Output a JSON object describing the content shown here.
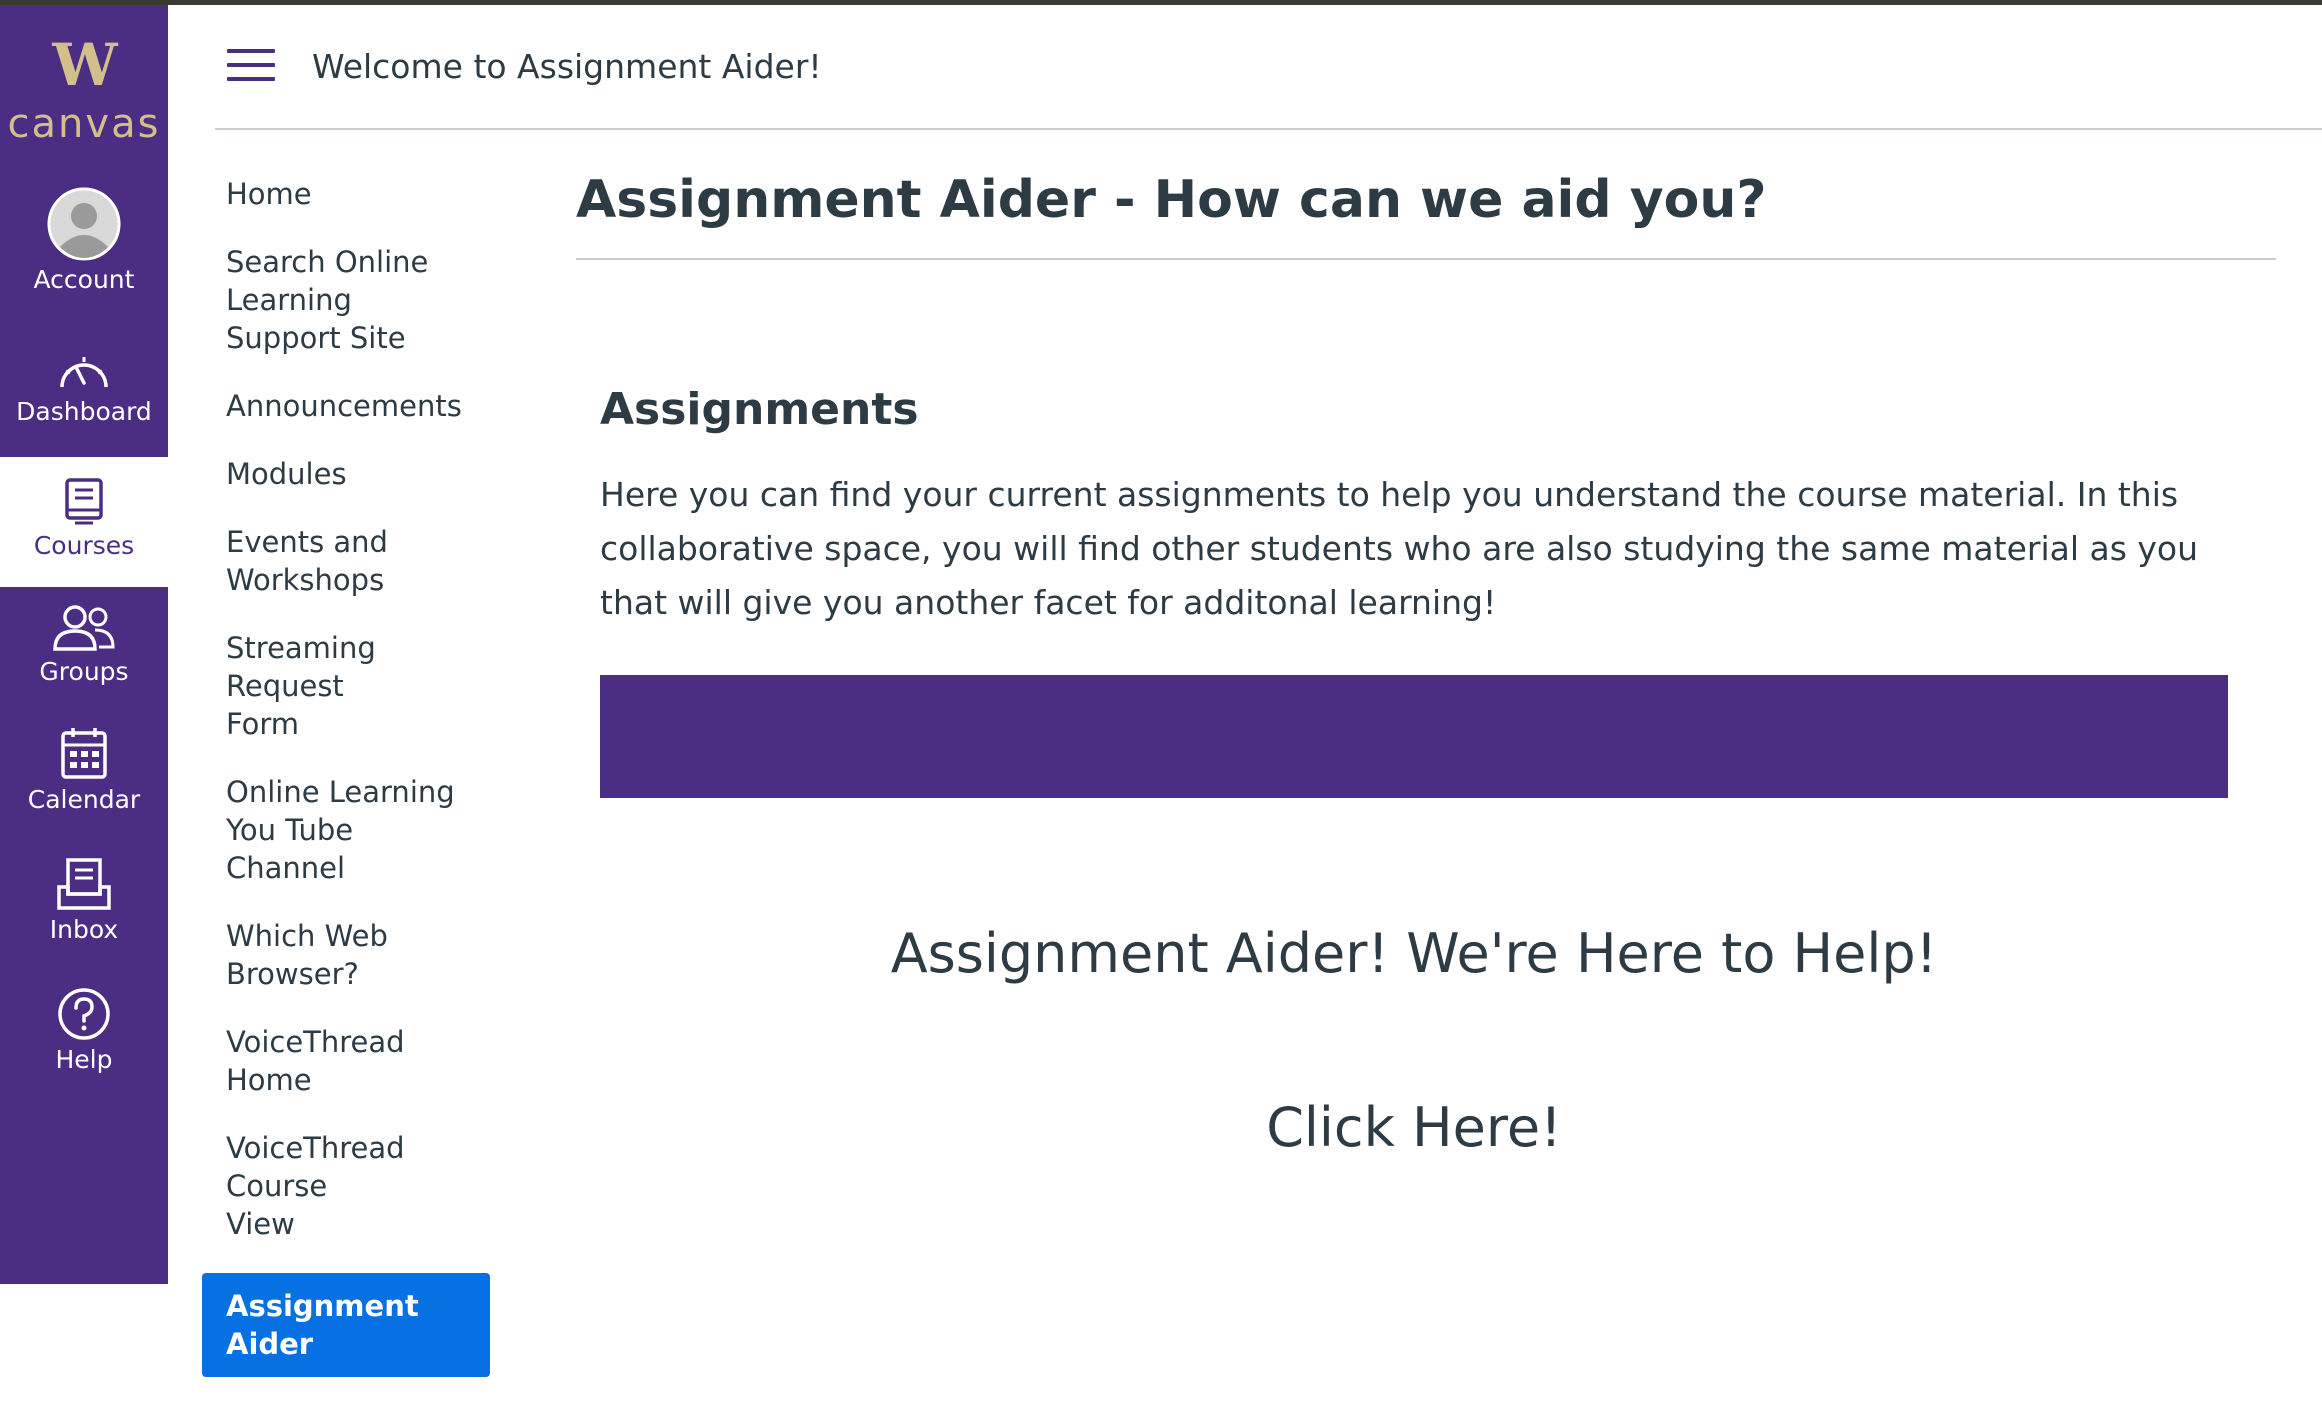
{
  "brand": {
    "logo_letter": "W",
    "logo_word": "canvas",
    "nav_color": "#4b2e83",
    "logo_color": "#d4be8a",
    "active_color": "#0770e3"
  },
  "global_nav": [
    {
      "label": "Account",
      "icon": "avatar-icon"
    },
    {
      "label": "Dashboard",
      "icon": "dashboard-icon"
    },
    {
      "label": "Courses",
      "icon": "courses-icon",
      "active": true
    },
    {
      "label": "Groups",
      "icon": "groups-icon"
    },
    {
      "label": "Calendar",
      "icon": "calendar-icon"
    },
    {
      "label": "Inbox",
      "icon": "inbox-icon"
    },
    {
      "label": "Help",
      "icon": "help-icon"
    }
  ],
  "header": {
    "title": "Welcome to Assignment Aider!"
  },
  "course_nav": [
    {
      "label": "Home"
    },
    {
      "label": "Search Online Learning Support Site"
    },
    {
      "label": "Announcements"
    },
    {
      "label": "Modules"
    },
    {
      "label": "Events and Workshops"
    },
    {
      "label": "Streaming Request Form"
    },
    {
      "label": "Online Learning You Tube Channel"
    },
    {
      "label": "Which Web Browser?"
    },
    {
      "label": "VoiceThread Home"
    },
    {
      "label": "VoiceThread Course View"
    },
    {
      "label": "Assignment Aider",
      "active": true
    }
  ],
  "main": {
    "page_title": "Assignment Aider - How can we aid you?",
    "section_title": "Assignments",
    "section_body": "Here you can find your current assignments to help you understand the course material. In this collaborative space, you will find other students who are also studying the same material as you that will give you another facet for additonal learning!",
    "tagline": "Assignment Aider! We're Here to Help!",
    "cta": "Click Here!"
  }
}
